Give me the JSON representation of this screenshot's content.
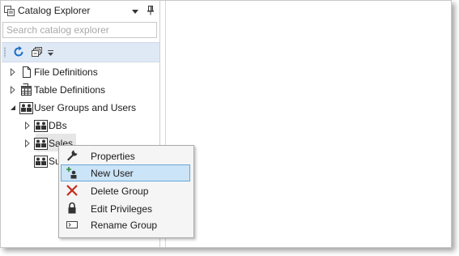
{
  "explorer": {
    "title": "Catalog Explorer",
    "search_placeholder": "Search catalog explorer",
    "tree": [
      {
        "label": "File Definitions",
        "icon": "file-icon"
      },
      {
        "label": "Table Definitions",
        "icon": "table-icon"
      },
      {
        "label": "User Groups and Users",
        "icon": "user-group-icon",
        "children": [
          {
            "label": "DBs",
            "icon": "user-group-icon"
          },
          {
            "label": "Sales",
            "icon": "user-group-icon"
          },
          {
            "label": "Su",
            "icon": "user-group-icon"
          }
        ]
      }
    ]
  },
  "context_menu": {
    "items": [
      {
        "label": "Properties",
        "icon": "wrench-icon"
      },
      {
        "label": "New User",
        "icon": "add-user-icon",
        "selected": true
      },
      {
        "label": "Delete Group",
        "icon": "delete-x-icon"
      },
      {
        "label": "Edit Privileges",
        "icon": "lock-icon"
      },
      {
        "label": "Rename Group",
        "icon": "rename-icon"
      }
    ]
  },
  "colors": {
    "toolbar_bg": "#dfe9f5",
    "selection_bg": "#cce4f7",
    "selection_border": "#66a7d8",
    "refresh_blue": "#1a6fc9",
    "delete_red": "#c42b1c"
  }
}
